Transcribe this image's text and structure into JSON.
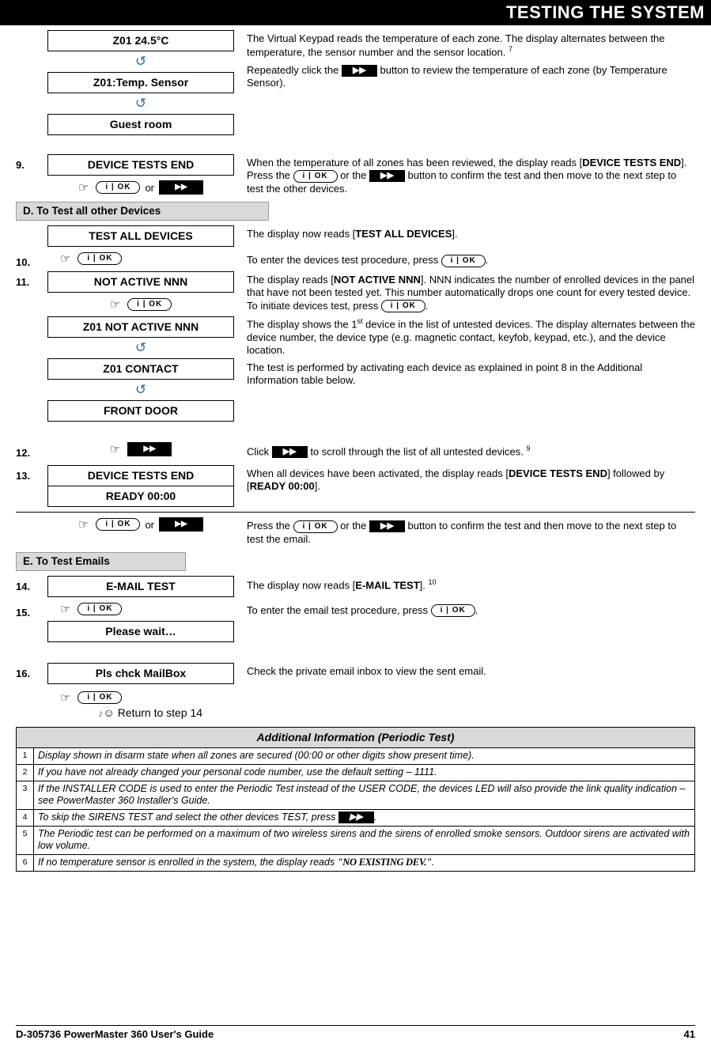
{
  "header": {
    "title": "TESTING THE SYSTEM"
  },
  "steps": {
    "temp": {
      "lcd1": "Z01 24.5°C",
      "lcd2": "Z01:Temp. Sensor",
      "lcd3": "Guest room",
      "text1": "The Virtual Keypad reads the temperature of each zone. The display alternates between the temperature, the sensor number and the sensor location. ",
      "note1": "7",
      "text2a": "Repeatedly click the ",
      "text2b": " button to review the temperature of each zone (by Temperature Sensor)."
    },
    "s9": {
      "num": "9.",
      "lcd": "DEVICE TESTS END",
      "or": "or",
      "text_a": "When the temperature of all zones has been reviewed, the display reads [",
      "text_b": "DEVICE TESTS END",
      "text_c": "]. Press the ",
      "text_d": " or the ",
      "text_e": " button to confirm the test and then move to the next step to test the other devices."
    },
    "sectionD": "D. To Test all other Devices",
    "testall": {
      "lcd": "TEST ALL DEVICES",
      "text_a": "The display now reads [",
      "text_b": "TEST ALL DEVICES",
      "text_c": "]."
    },
    "s10": {
      "num": "10.",
      "text_a": "To enter the devices test procedure, press ",
      "text_b": "."
    },
    "s11": {
      "num": "11.",
      "lcd1": "NOT ACTIVE NNN",
      "lcd2": "Z01 NOT ACTIVE NNN",
      "lcd3": "Z01 CONTACT",
      "lcd4": "FRONT DOOR",
      "p1_a": "The display reads [",
      "p1_b": "NOT ACTIVE NNN",
      "p1_c": "]. NNN indicates the number of enrolled devices in the panel that have not been tested yet. This number automatically drops one count for every tested device. To initiate devices test, press ",
      "p1_d": ".",
      "p2_a": "The display shows the 1",
      "p2_sup": "st",
      "p2_b": " device in the list of untested devices. The display alternates between the device number, the device type (e.g. magnetic contact, keyfob, keypad, etc.), and the device location.",
      "p3": "The test is performed by activating each device as explained in point 8 in the Additional Information table below."
    },
    "s12": {
      "num": "12.",
      "text_a": "Click ",
      "text_b": " to scroll through the list of all untested devices. ",
      "note": "9"
    },
    "s13": {
      "num": "13.",
      "lcd1": "DEVICE TESTS END",
      "lcd2": "READY 00:00",
      "text_a": "When all devices have been activated, the display reads [",
      "text_b": "DEVICE TESTS END",
      "text_c": "] followed by [",
      "text_d": "READY 00:00",
      "text_e": "]."
    },
    "s13b": {
      "or": "or",
      "text_a": "Press the ",
      "text_b": " or the ",
      "text_c": " button to confirm the test and then move to the next step to test the email."
    },
    "sectionE": "E. To Test Emails",
    "s14": {
      "num": "14.",
      "lcd": "E-MAIL TEST",
      "text_a": "The display now reads [",
      "text_b": "E-MAIL TEST",
      "text_c": "]. ",
      "note": "10"
    },
    "s15": {
      "num": "15.",
      "lcd": "Please wait…",
      "text_a": "To enter the email test procedure, press ",
      "text_b": "."
    },
    "s16": {
      "num": "16.",
      "lcd": "Pls chck MailBox",
      "text": "Check the private email inbox to view the sent email.",
      "return": "Return to step 14"
    }
  },
  "keys": {
    "ok": "OK",
    "ok_prefix": "i",
    "next": "▶▶"
  },
  "table": {
    "title": "Additional Information (Periodic Test)",
    "rows": [
      {
        "idx": "1",
        "text": "Display shown in disarm state when all zones are secured (00:00 or other digits show present time)."
      },
      {
        "idx": "2",
        "text": "If you have not already changed your personal code number, use the default setting – 1111."
      },
      {
        "idx": "3",
        "text": "If the INSTALLER CODE is used to enter the Periodic Test instead of the USER CODE, the devices LED will also provide the link quality indication – see PowerMaster 360 Installer's Guide."
      },
      {
        "idx": "4",
        "text_a": "To skip the SIRENS TEST and select the other devices TEST, press ",
        "text_b": "."
      },
      {
        "idx": "5",
        "text": "The Periodic test can be performed on a maximum of two wireless sirens and the sirens of enrolled smoke sensors. Outdoor sirens are activated with low volume."
      },
      {
        "idx": "6",
        "text_a": "If no temperature sensor is enrolled in the system, the display reads  ",
        "quote": "\"NO EXISTING DEV.\"",
        "text_b": "."
      }
    ]
  },
  "footer": {
    "left": "D-305736 PowerMaster 360 User's Guide",
    "right": "41"
  }
}
